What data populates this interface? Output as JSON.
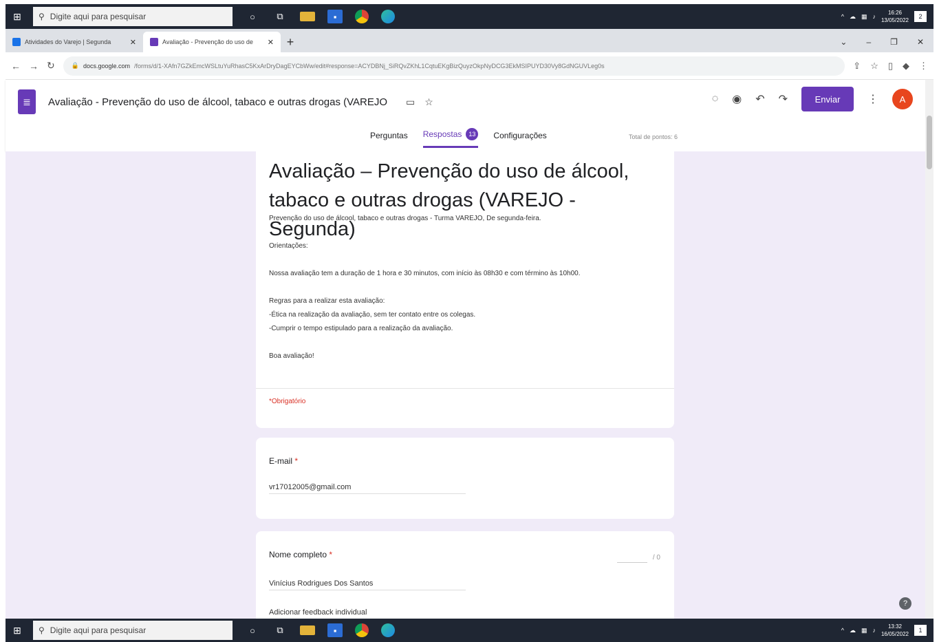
{
  "taskbar_top": {
    "search_placeholder": "Digite aqui para pesquisar",
    "time": "16:26",
    "date": "13/05/2022",
    "notif": "2"
  },
  "taskbar_bottom": {
    "search_placeholder": "Digite aqui para pesquisar",
    "time": "13:32",
    "date": "16/05/2022",
    "notif": "1"
  },
  "browser": {
    "tabs": [
      {
        "title": "Atividades do Varejo | Segunda"
      },
      {
        "title": "Avaliação - Prevenção do uso de"
      }
    ],
    "url_host": "docs.google.com",
    "url_path": "/forms/d/1-XAfn7GZkEmcWSLtuYuRhasC5KxArDryDagEYCbWw/edit#response=ACYDBNj_SiRQvZKhL1CqtuEKgBizQuyzOkpNyDCG3EkMSIPUYD30Vy8GdNGUVLeg0s"
  },
  "form": {
    "doc_title": "Avaliação - Prevenção do uso de álcool, tabaco e outras drogas (VAREJO",
    "send_label": "Enviar",
    "avatar_letter": "A",
    "tabs": {
      "questions": "Perguntas",
      "responses": "Respostas",
      "responses_count": "13",
      "settings": "Configurações"
    },
    "total_points": "Total de pontos: 6"
  },
  "title_card": {
    "heading": "Avaliação – Prevenção do uso de álcool, tabaco e outras drogas  (VAREJO - Segunda)",
    "description": "Prevenção do uso de álcool, tabaco e outras drogas  - Turma VAREJO, De segunda-feira.",
    "orientations": "Orientações:",
    "duration": "Nossa avaliação tem a duração de  1 hora e 30 minutos, com início às 08h30 e com término às 10h00.",
    "rules_title": "Regras para a realizar esta avaliação:",
    "rule1": "-Ética na realização da avaliação, sem ter contato entre os colegas.",
    "rule2": "-Cumprir o tempo estipulado para a realização da avaliação.",
    "closing": "Boa avaliação!",
    "required": "*Obrigatório"
  },
  "questions": [
    {
      "label": "E-mail",
      "answer": "vr17012005@gmail.com"
    },
    {
      "label": "Nome completo",
      "answer": "Vinícius Rodrigues Dos Santos",
      "score_suffix": "/ 0",
      "feedback": "Adicionar feedback individual"
    }
  ]
}
